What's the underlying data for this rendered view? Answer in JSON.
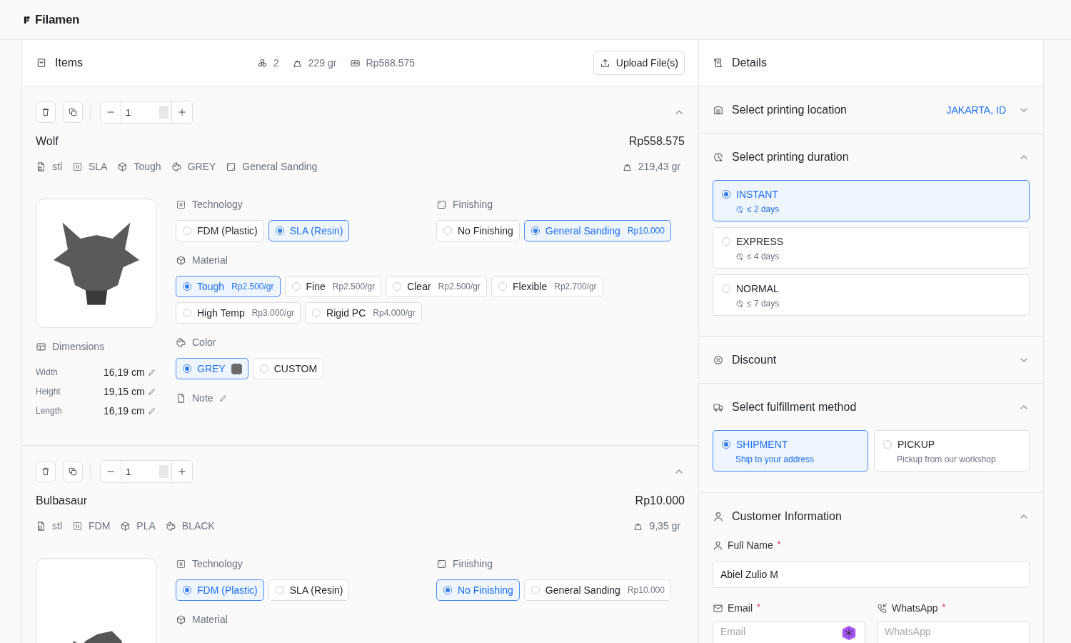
{
  "header": {
    "logo": "Filamen"
  },
  "items_panel": {
    "title": "Items",
    "count": "2",
    "weight": "229 gr",
    "total": "Rp588.575",
    "upload_button": "Upload File(s)"
  },
  "items": [
    {
      "quantity": "1",
      "expanded": true,
      "name": "Wolf",
      "price": "Rp558.575",
      "weight": "219,43 gr",
      "kind": "wolf",
      "tags": [
        {
          "kind": "file",
          "text": "stl"
        },
        {
          "kind": "tech",
          "text": "SLA"
        },
        {
          "kind": "material",
          "text": "Tough"
        },
        {
          "kind": "color",
          "text": "GREY"
        },
        {
          "kind": "finishing",
          "text": "General Sanding"
        }
      ],
      "dimensions": {
        "label": "Dimensions",
        "rows": [
          {
            "label": "Width",
            "value": "16,19 cm"
          },
          {
            "label": "Height",
            "value": "19,15 cm"
          },
          {
            "label": "Length",
            "value": "16,19 cm"
          }
        ]
      },
      "technology": {
        "label": "Technology",
        "options": [
          {
            "label": "FDM (Plastic)",
            "selected": false
          },
          {
            "label": "SLA (Resin)",
            "selected": true
          }
        ]
      },
      "finishing": {
        "label": "Finishing",
        "options": [
          {
            "label": "No Finishing",
            "selected": false
          },
          {
            "label": "General Sanding",
            "price": "Rp10.000",
            "selected": true
          }
        ]
      },
      "material": {
        "label": "Material",
        "options": [
          {
            "label": "Tough",
            "price": "Rp2.500/gr",
            "selected": true
          },
          {
            "label": "Fine",
            "price": "Rp2.500/gr",
            "selected": false
          },
          {
            "label": "Clear",
            "price": "Rp2.500/gr",
            "selected": false
          },
          {
            "label": "Flexible",
            "price": "Rp2.700/gr",
            "selected": false
          },
          {
            "label": "High Temp",
            "price": "Rp3.000/gr",
            "selected": false
          },
          {
            "label": "Rigid PC",
            "price": "Rp4.000/gr",
            "selected": false
          }
        ]
      },
      "color": {
        "label": "Color",
        "options": [
          {
            "label": "GREY",
            "color": "#6b6b6b",
            "selected": true
          },
          {
            "label": "CUSTOM",
            "selected": false
          }
        ]
      },
      "note": {
        "label": "Note"
      }
    },
    {
      "quantity": "1",
      "expanded": true,
      "name": "Bulbasaur",
      "price": "Rp10.000",
      "weight": "9,35 gr",
      "kind": "bulbasaur",
      "tags": [
        {
          "kind": "file",
          "text": "stl"
        },
        {
          "kind": "tech",
          "text": "FDM"
        },
        {
          "kind": "material",
          "text": "PLA"
        },
        {
          "kind": "color",
          "text": "BLACK"
        }
      ],
      "technology": {
        "label": "Technology",
        "options": [
          {
            "label": "FDM (Plastic)",
            "selected": true
          },
          {
            "label": "SLA (Resin)",
            "selected": false
          }
        ]
      },
      "finishing": {
        "label": "Finishing",
        "options": [
          {
            "label": "No Finishing",
            "selected": true
          },
          {
            "label": "General Sanding",
            "price": "Rp10.000",
            "selected": false
          }
        ]
      },
      "material": {
        "label": "Material"
      }
    }
  ],
  "details": {
    "title": "Details",
    "location": {
      "label": "Select printing location",
      "value": "JAKARTA, ID",
      "expanded": false
    },
    "duration": {
      "label": "Select printing duration",
      "expanded": true,
      "options": [
        {
          "label": "INSTANT",
          "time": "≤ 2 days",
          "selected": true
        },
        {
          "label": "EXPRESS",
          "time": "≤ 4 days",
          "selected": false
        },
        {
          "label": "NORMAL",
          "time": "≤ 7 days",
          "selected": false
        }
      ]
    },
    "discount": {
      "label": "Discount",
      "expanded": false
    },
    "fulfillment": {
      "label": "Select fulfillment method",
      "expanded": true,
      "options": [
        {
          "label": "SHIPMENT",
          "description": "Ship to your address",
          "selected": true
        },
        {
          "label": "PICKUP",
          "description": "Pickup from our workshop",
          "selected": false
        }
      ]
    },
    "customer": {
      "label": "Customer Information",
      "expanded": true,
      "full_name": {
        "label": "Full Name",
        "required_mark": "*",
        "value": "Abiel Zulio M"
      },
      "email": {
        "label": "Email",
        "required_mark": "*",
        "placeholder": "Email"
      },
      "whatsapp": {
        "label": "WhatsApp",
        "required_mark": "*",
        "placeholder": "WhatsApp"
      }
    }
  }
}
